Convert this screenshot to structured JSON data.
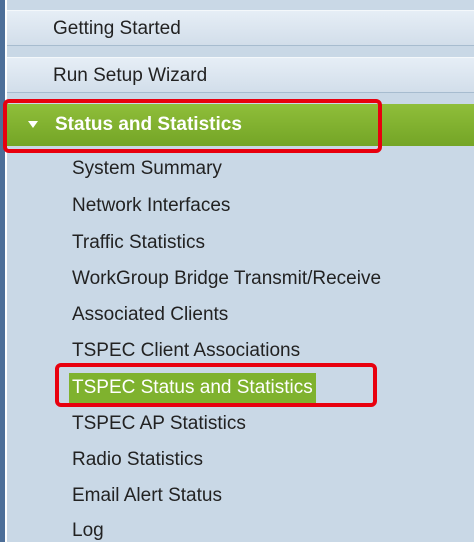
{
  "nav": {
    "getting_started": "Getting Started",
    "run_setup_wizard": "Run Setup Wizard",
    "section": {
      "label": "Status and Statistics",
      "expanded": true
    },
    "sub_items": [
      {
        "label": "System Summary"
      },
      {
        "label": "Network Interfaces"
      },
      {
        "label": "Traffic Statistics"
      },
      {
        "label": "WorkGroup Bridge Transmit/Receive"
      },
      {
        "label": "Associated Clients"
      },
      {
        "label": "TSPEC Client Associations"
      },
      {
        "label": "TSPEC Status and Statistics",
        "active": true
      },
      {
        "label": "TSPEC AP Statistics"
      },
      {
        "label": "Radio Statistics"
      },
      {
        "label": "Email Alert Status"
      },
      {
        "label": "Log"
      }
    ]
  },
  "colors": {
    "nav_background": "#c9d8e6",
    "section_header": "#7fb22e",
    "highlight_outline": "#e8000e",
    "left_rule": "#4d6f99"
  }
}
